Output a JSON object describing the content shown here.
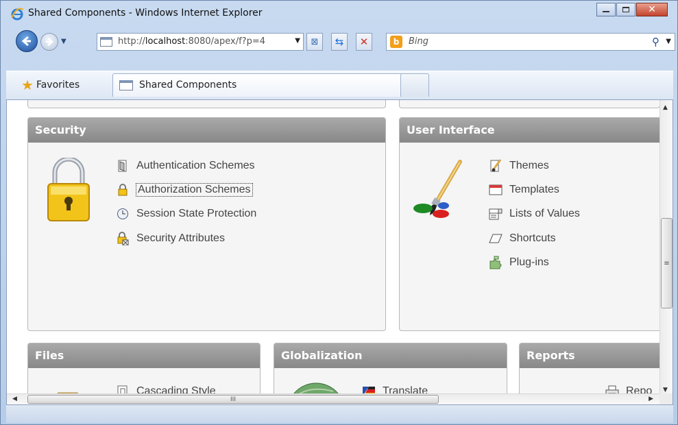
{
  "window": {
    "title": "Shared Components - Windows Internet Explorer"
  },
  "nav": {
    "address_prefix": "http://",
    "address_host": "localhost",
    "address_rest": ":8080/apex/f?p=4",
    "search_placeholder": "Bing"
  },
  "favorites": {
    "label": "Favorites"
  },
  "tabs": {
    "active_label": "Shared Components"
  },
  "panels": {
    "security": {
      "title": "Security",
      "items": [
        {
          "label": "Authentication Schemes",
          "icon": "door-icon"
        },
        {
          "label": "Authorization Schemes",
          "icon": "padlock-icon"
        },
        {
          "label": "Session State Protection",
          "icon": "clock-icon"
        },
        {
          "label": "Security Attributes",
          "icon": "lock-attributes-icon"
        }
      ]
    },
    "user_interface": {
      "title": "User Interface",
      "items": [
        {
          "label": "Themes",
          "icon": "brush-icon"
        },
        {
          "label": "Templates",
          "icon": "template-icon"
        },
        {
          "label": "Lists of Values",
          "icon": "list-icon"
        },
        {
          "label": "Shortcuts",
          "icon": "shortcut-icon"
        },
        {
          "label": "Plug-ins",
          "icon": "puzzle-icon"
        }
      ]
    },
    "files": {
      "title": "Files",
      "items": [
        {
          "label": "Cascading Style",
          "icon": "file-icon"
        }
      ]
    },
    "globalization": {
      "title": "Globalization",
      "items": [
        {
          "label": "Translate",
          "icon": "flag-icon"
        }
      ]
    },
    "reports": {
      "title": "Reports",
      "items": [
        {
          "label": "Repo",
          "icon": "printer-icon"
        }
      ]
    }
  },
  "scrollbar": {
    "thumb_grip": "≡",
    "h_thumb_grip": "III"
  }
}
